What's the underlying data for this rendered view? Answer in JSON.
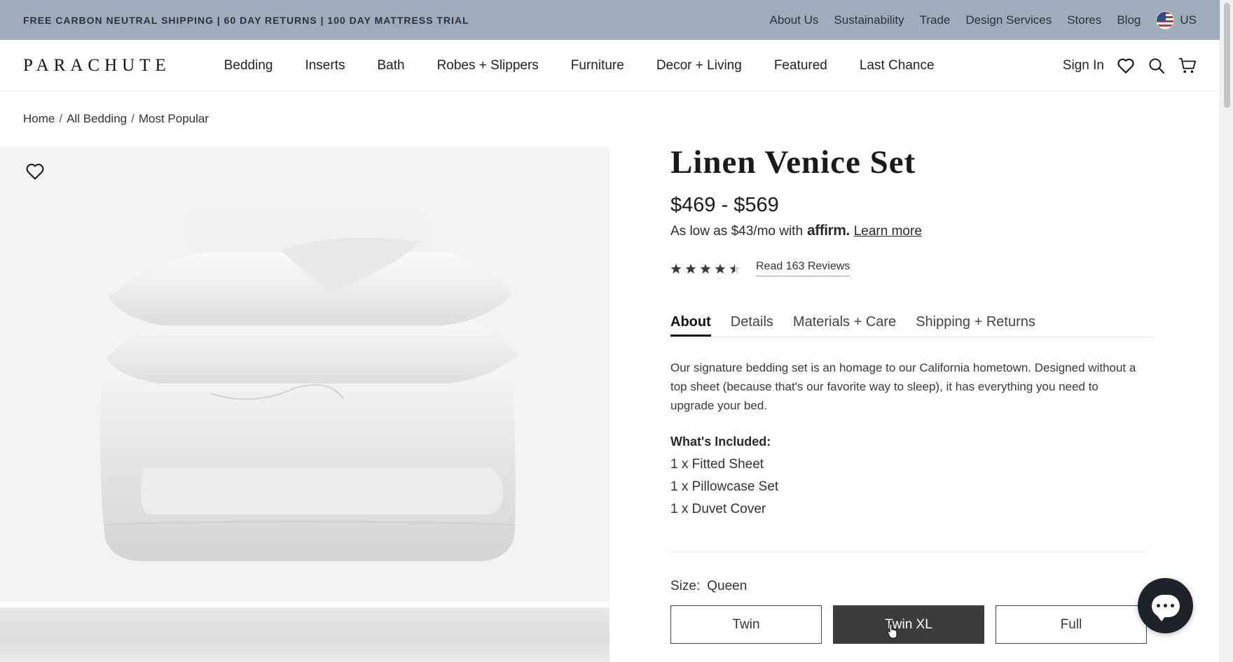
{
  "promo": {
    "text": "FREE CARBON NEUTRAL SHIPPING | 60 DAY RETURNS | 100 DAY MATTRESS TRIAL",
    "links": [
      "About Us",
      "Sustainability",
      "Trade",
      "Design Services",
      "Stores",
      "Blog"
    ],
    "locale": "US"
  },
  "nav": {
    "logo": "PARACHUTE",
    "menu": [
      "Bedding",
      "Inserts",
      "Bath",
      "Robes + Slippers",
      "Furniture",
      "Decor + Living",
      "Featured",
      "Last Chance"
    ],
    "sign_in": "Sign In"
  },
  "breadcrumb": [
    "Home",
    "All Bedding",
    "Most Popular"
  ],
  "product": {
    "title": "Linen Venice Set",
    "price": "$469 - $569",
    "financing_prefix": "As low as $43/mo with",
    "affirm": "affirm",
    "learn_more": "Learn more",
    "rating": 4.5,
    "reviews_link": "Read 163 Reviews",
    "tabs": [
      "About",
      "Details",
      "Materials + Care",
      "Shipping + Returns"
    ],
    "active_tab": "About",
    "description": "Our signature bedding set is an homage to our California hometown. Designed without a top sheet (because that's our favorite way to sleep), it has everything you need to upgrade your bed.",
    "included_heading": "What's Included:",
    "included": [
      "1 x Fitted Sheet",
      "1 x Pillowcase Set",
      "1 x Duvet Cover"
    ],
    "size_label": "Size:",
    "size_value": "Queen",
    "sizes": [
      "Twin",
      "Twin XL",
      "Full"
    ],
    "selected_size": "Twin XL"
  },
  "icons": {
    "heart": "heart-icon",
    "search": "search-icon",
    "cart": "cart-icon",
    "chat": "chat-icon"
  },
  "colors": {
    "promo_bg": "#9eadbc",
    "selected_size_bg": "#3c3c3c",
    "chat_bg": "#1f2228"
  }
}
